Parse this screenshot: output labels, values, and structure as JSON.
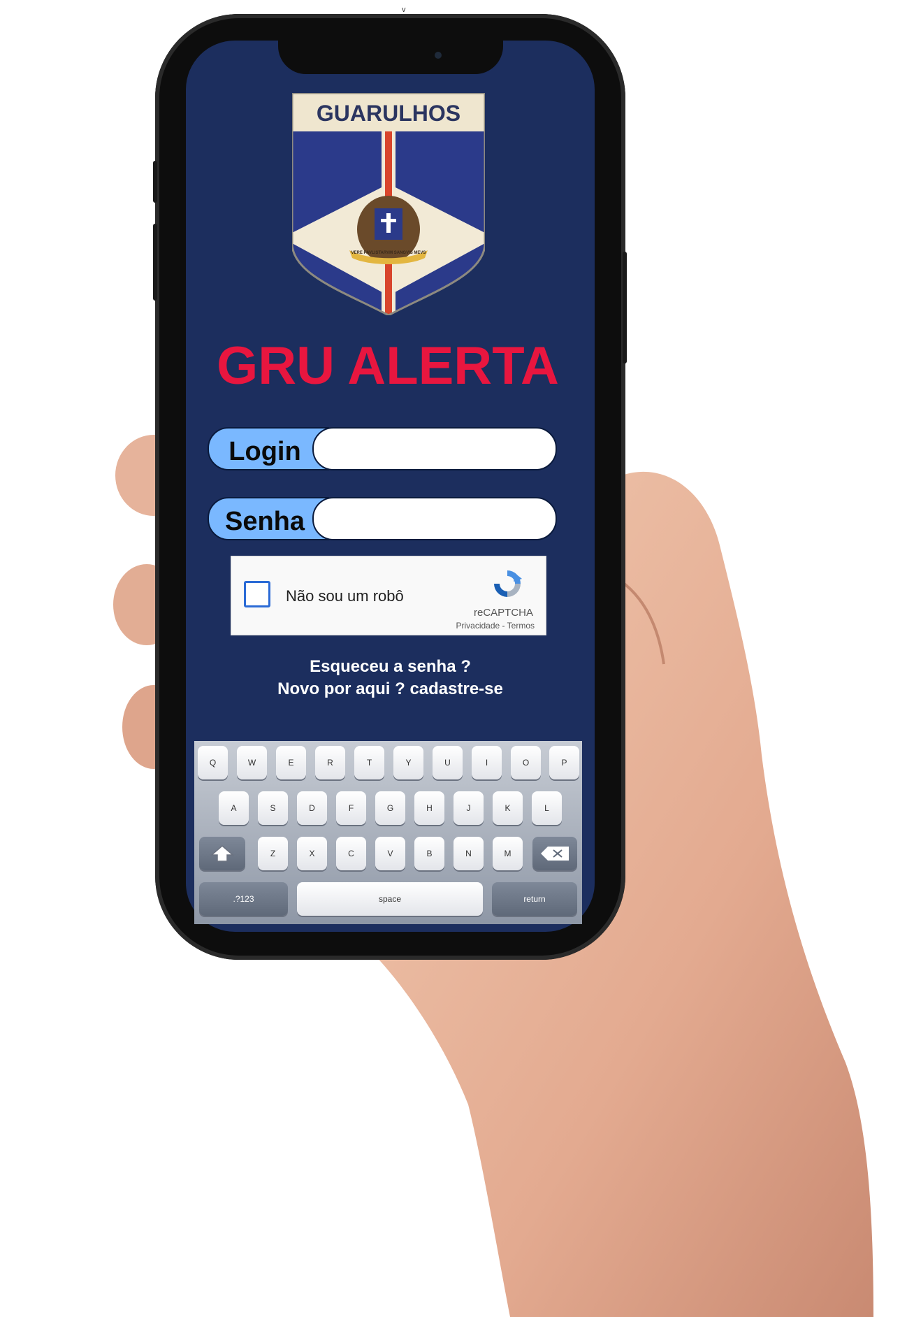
{
  "top_mark": "v",
  "crest": {
    "banner": "GUARULHOS",
    "motto": "VERE PAVLISTARVM SANGVIS MEVS"
  },
  "app": {
    "title": "GRU ALERTA"
  },
  "form": {
    "login_label": "Login",
    "login_value": "",
    "password_label": "Senha",
    "password_value": ""
  },
  "captcha": {
    "label": "Não sou um robô",
    "brand": "reCAPTCHA",
    "links": "Privacidade - Termos"
  },
  "links": {
    "forgot": "Esqueceu a senha ?",
    "register": "Novo por aqui ? cadastre-se"
  },
  "keyboard": {
    "row1": [
      "Q",
      "W",
      "E",
      "R",
      "T",
      "Y",
      "U",
      "I",
      "O",
      "P"
    ],
    "row2": [
      "A",
      "S",
      "D",
      "F",
      "G",
      "H",
      "J",
      "K",
      "L"
    ],
    "row3": [
      "Z",
      "X",
      "C",
      "V",
      "B",
      "N",
      "M"
    ],
    "numbers": ".?123",
    "space": "space",
    "return": "return"
  },
  "colors": {
    "screen_bg": "#1c2e5e",
    "title": "#e8163f",
    "field_tag": "#7ab8ff"
  }
}
